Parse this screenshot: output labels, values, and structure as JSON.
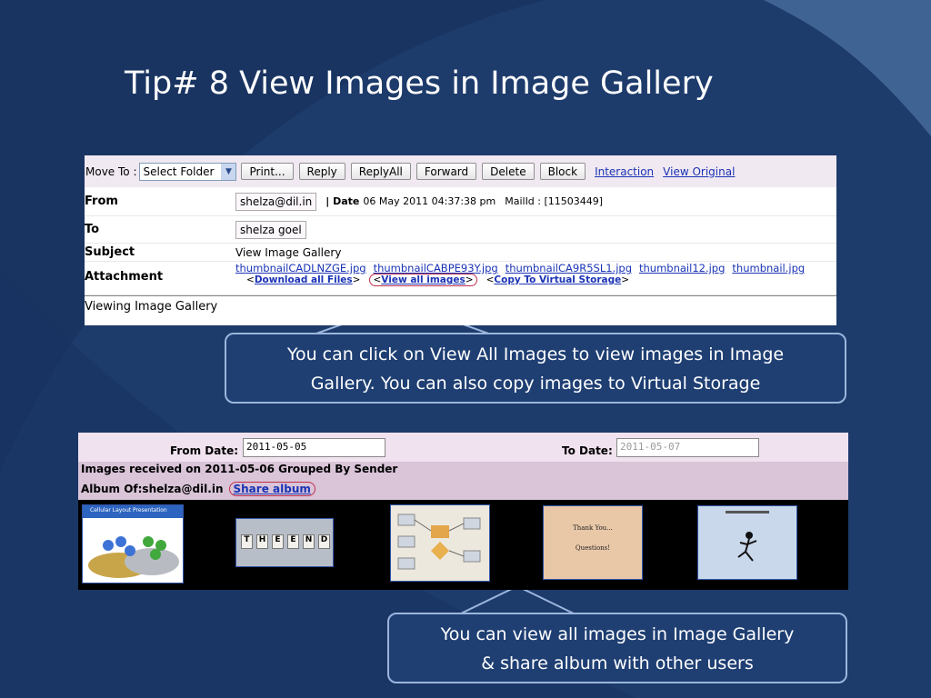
{
  "slide": {
    "title": "Tip# 8 View Images in Image Gallery",
    "background_color": "#1d3b6b",
    "accent_color": "#9bb5dc"
  },
  "mail": {
    "toolbar": {
      "move_to_label": "Move To :",
      "folder_select_value": "Select Folder",
      "buttons": [
        "Print...",
        "ReplyAll",
        "Forward",
        "Delete",
        "Block"
      ],
      "reply_label": "Reply",
      "links": [
        "Interaction",
        "View Original"
      ]
    },
    "from_label": "From",
    "from_value": "shelza@dil.in",
    "date_label": "| Date",
    "date_value": "06 May 2011 04:37:38 pm",
    "mailid": "MailId : [11503449]",
    "to_label": "To",
    "to_value": "shelza goel",
    "subject_label": "Subject",
    "subject_value": "View Image Gallery",
    "attachment_label": "Attachment",
    "files": [
      "thumbnailCADLNZGE.jpg",
      "thumbnailCABPE93Y.jpg",
      "thumbnailCA9R5SL1.jpg",
      "thumbnail12.jpg",
      "thumbnail.jpg"
    ],
    "download_all": "Download all Files",
    "view_all": "View all images",
    "copy_virtual": "Copy To Virtual Storage",
    "body_text": "Viewing Image Gallery"
  },
  "callout1": {
    "line1": "You can click on View All Images to view images in Image",
    "line2": "Gallery. You can also copy images to Virtual Storage"
  },
  "gallery": {
    "from_date_label": "From Date:",
    "from_date_value": "2011-05-05",
    "to_date_label": "To Date:",
    "to_date_value": "2011-05-07",
    "group_heading": "Images received on 2011-05-06 Grouped By Sender",
    "album_of": "Album Of:shelza@dil.in",
    "share_album": "Share album",
    "thumb1_caption": "Cellular Layout Presentation",
    "thumb2_letters": [
      "T",
      "H",
      "E",
      "E",
      "N",
      "D"
    ],
    "thumb4_title": "Thank You...",
    "thumb4_sub": "Questions!"
  },
  "callout2": {
    "line1": "You can view all images in Image Gallery",
    "line2": "& share album with other users"
  }
}
